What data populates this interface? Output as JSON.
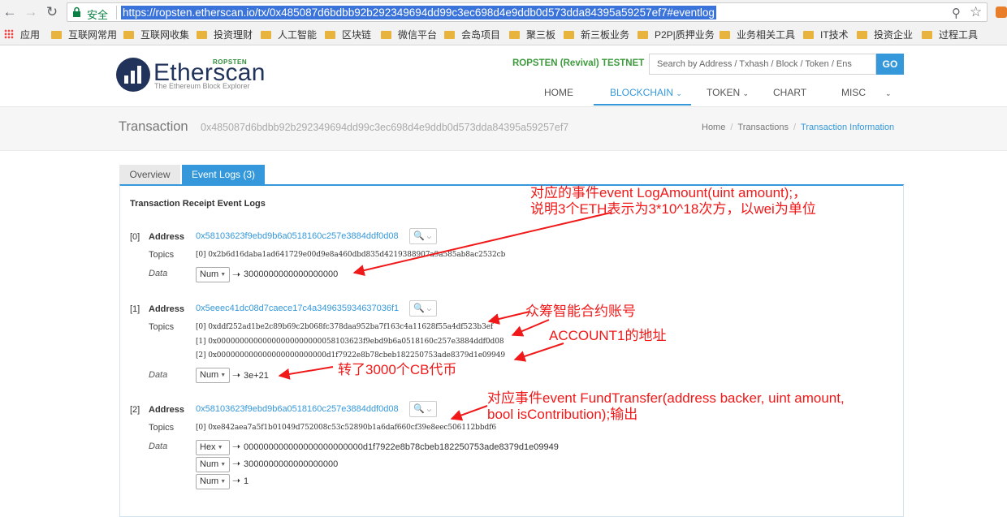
{
  "browser": {
    "secure_label": "安全",
    "url": "https://ropsten.etherscan.io/tx/0x485087d6bdbb92b292349694dd99c3ec698d4e9ddb0d573dda84395a59257ef7#eventlog",
    "bookmarks": [
      "应用",
      "互联网常用",
      "互联网收集",
      "投资理财",
      "人工智能",
      "区块链",
      "微信平台",
      "会岛项目",
      "聚三板",
      "新三板业务",
      "P2P|质押业务",
      "业务相关工具",
      "IT技术",
      "投资企业",
      "过程工具"
    ]
  },
  "site": {
    "logo_text": "Etherscan",
    "logo_network": "ROPSTEN",
    "logo_subtitle": "The Ethereum Block Explorer",
    "network_label": "ROPSTEN (Revival) TESTNET",
    "search_placeholder": "Search by Address / Txhash / Block / Token / Ens",
    "go_label": "GO",
    "menu": [
      "HOME",
      "BLOCKCHAIN",
      "TOKEN",
      "CHART",
      "MISC"
    ]
  },
  "page": {
    "title": "Transaction",
    "hash": "0x485087d6bdbb92b292349694dd99c3ec698d4e9ddb0d573dda84395a59257ef7",
    "breadcrumb": [
      "Home",
      "Transactions",
      "Transaction Information"
    ]
  },
  "tabs": [
    "Overview",
    "Event Logs (3)"
  ],
  "panel_title": "Transaction Receipt Event Logs",
  "labels": {
    "address": "Address",
    "topics": "Topics",
    "data": "Data"
  },
  "logs": [
    {
      "index": "[0]",
      "address": "0x58103623f9ebd9b6a0518160c257e3884ddf0d08",
      "topics": [
        "[0] 0x2b6d16daba1ad641729e00d9e8a460dbd835d4219388907a9a585ab8ac2532cb"
      ],
      "data": [
        {
          "format": "Num",
          "value": "3000000000000000000"
        }
      ]
    },
    {
      "index": "[1]",
      "address": "0x5eeec41dc08d7caece17c4a349635934637036f1",
      "topics": [
        "[0] 0xddf252ad1be2c89b69c2b068fc378daa952ba7f163c4a11628f55a4df523b3ef",
        "[1] 0x00000000000000000000000058103623f9ebd9b6a0518160c257e3884ddf0d08",
        "[2] 0x000000000000000000000000d1f7922e8b78cbeb182250753ade8379d1e09949"
      ],
      "data": [
        {
          "format": "Num",
          "value": "3e+21"
        }
      ]
    },
    {
      "index": "[2]",
      "address": "0x58103623f9ebd9b6a0518160c257e3884ddf0d08",
      "topics": [
        "[0] 0xe842aea7a5f1b01049d752008c53c52890b1a6daf660cf39e8eec506112bbdf6"
      ],
      "data": [
        {
          "format": "Hex",
          "value": "000000000000000000000000d1f7922e8b78cbeb182250753ade8379d1e09949"
        },
        {
          "format": "Num",
          "value": "3000000000000000000"
        },
        {
          "format": "Num",
          "value": "1"
        }
      ]
    }
  ],
  "annotations": {
    "note1_line1": "对应的事件event LogAmount(uint amount);，",
    "note1_line2": "说明3个ETH表示为3*10^18次方，以wei为单位",
    "note2": "众筹智能合约账号",
    "note3": "ACCOUNT1的地址",
    "note4": "转了3000个CB代币",
    "note5_line1": "对应事件event FundTransfer(address backer, uint amount,",
    "note5_line2": "bool isContribution);输出"
  },
  "colors": {
    "accent": "#3498db",
    "annotation": "#f01818",
    "testnet": "#3d9a3d"
  }
}
